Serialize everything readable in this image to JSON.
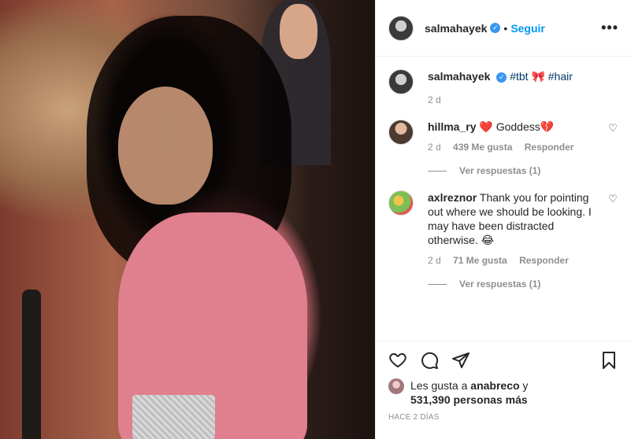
{
  "post": {
    "author": "salmahayek",
    "follow_label": "Seguir",
    "more_label": "•••"
  },
  "caption": {
    "author": "salmahayek",
    "tags": "#tbt",
    "emoji": "🎀",
    "tag2": "#hair",
    "time": "2 d"
  },
  "comments": [
    {
      "user": "hillma_ry",
      "text": "❤️ Goddess💔",
      "time": "2 d",
      "likes": "439 Me gusta",
      "reply": "Responder",
      "replies": "Ver respuestas (1)"
    },
    {
      "user": "axlreznor",
      "text": "Thank you for pointing out where we should be looking. I may have been distracted otherwise. 😂",
      "time": "2 d",
      "likes": "71 Me gusta",
      "reply": "Responder",
      "replies": "Ver respuestas (1)"
    }
  ],
  "likes": {
    "prefix": "Les gusta a",
    "user": "anabreco",
    "middle": "y",
    "count": "531,390 personas más"
  },
  "timestamp": "HACE 2 DÍAS",
  "icons": [
    "heart-icon",
    "comment-icon",
    "share-icon",
    "bookmark-icon",
    "more-icon",
    "verified-icon"
  ],
  "colors": {
    "accent": "#0095f6",
    "verified": "#3897f0",
    "muted": "#8e8e8e",
    "text": "#262626"
  }
}
